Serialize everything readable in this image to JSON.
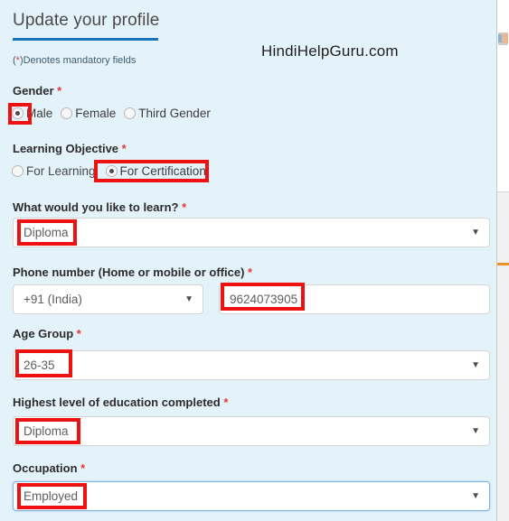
{
  "page": {
    "title": "Update your profile",
    "watermark": "HindiHelpGuru.com",
    "mandatory_note_prefix": "(",
    "mandatory_note_star": "*",
    "mandatory_note_suffix": ")Denotes mandatory fields",
    "required_marker": "*",
    "background_color": "#e4f2fa",
    "accent_color": "#1b73b8",
    "highlight_color": "#ee1111",
    "caret_glyph": "▼"
  },
  "fields": {
    "gender": {
      "label": "Gender",
      "required_marker": "*",
      "options": [
        {
          "label": "Male",
          "selected": true
        },
        {
          "label": "Female",
          "selected": false
        },
        {
          "label": "Third Gender",
          "selected": false
        }
      ]
    },
    "learning_objective": {
      "label": "Learning Objective",
      "required_marker": "*",
      "options": [
        {
          "label": "For Learning",
          "selected": false
        },
        {
          "label": "For Certification",
          "selected": true
        }
      ]
    },
    "learn_topic": {
      "label": "What would you like to learn?",
      "required_marker": "*",
      "value": "Diploma"
    },
    "phone": {
      "label": "Phone number (Home or mobile or office)",
      "required_marker": "*",
      "country_code": "+91 (India)",
      "number": "9624073905"
    },
    "age_group": {
      "label": "Age Group",
      "required_marker": "*",
      "value": "26-35"
    },
    "education": {
      "label": "Highest level of education completed",
      "required_marker": "*",
      "value": "Diploma"
    },
    "occupation": {
      "label": "Occupation",
      "required_marker": "*",
      "value": "Employed"
    }
  }
}
